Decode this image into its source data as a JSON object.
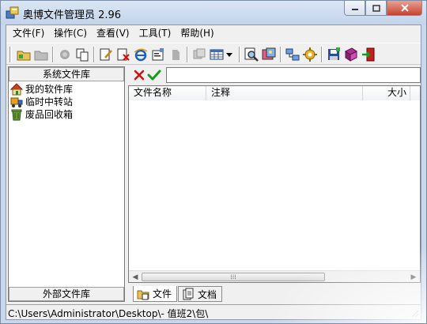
{
  "window": {
    "title": "奥博文件管理员 2.96",
    "app_icon": "app-icon"
  },
  "menubar": {
    "items": [
      {
        "label": "文件(F)"
      },
      {
        "label": "操作(C)"
      },
      {
        "label": "查看(V)"
      },
      {
        "label": "工具(T)"
      },
      {
        "label": "帮助(H)"
      }
    ]
  },
  "toolbar": {
    "icons": [
      "add-folder-icon",
      "folder-disabled-icon",
      "copy-disabled-icon",
      "move-icon",
      "edit-icon",
      "delete-icon",
      "internet-icon",
      "properties-icon",
      "open-disabled-icon",
      "window-disabled-icon",
      "view-grid-icon",
      "dropdown-icon",
      "search-icon",
      "image-icon",
      "network-icon",
      "settings-icon",
      "save-icon",
      "book-icon",
      "exit-icon"
    ]
  },
  "left_panel": {
    "top_header": "系统文件库",
    "bottom_header": "外部文件库",
    "tree": [
      {
        "label": "我的软件库",
        "icon": "home-icon"
      },
      {
        "label": "临时中转站",
        "icon": "truck-icon"
      },
      {
        "label": "废品回收箱",
        "icon": "recycle-bin-icon"
      }
    ]
  },
  "right_panel": {
    "path_value": "",
    "columns": [
      {
        "label": "文件名称"
      },
      {
        "label": "注释"
      },
      {
        "label": "大小"
      }
    ],
    "tabs": [
      {
        "label": "文件",
        "icon": "file-icon"
      },
      {
        "label": "文档",
        "icon": "document-icon"
      }
    ]
  },
  "statusbar": {
    "text": "C:\\Users\\Administrator\\Desktop\\-  值班2\\包\\"
  },
  "colors": {
    "title_bar": "#c9d7ea",
    "close_button": "#c7432e",
    "delete_red": "#d01010",
    "confirm_green": "#1a9a1a"
  }
}
